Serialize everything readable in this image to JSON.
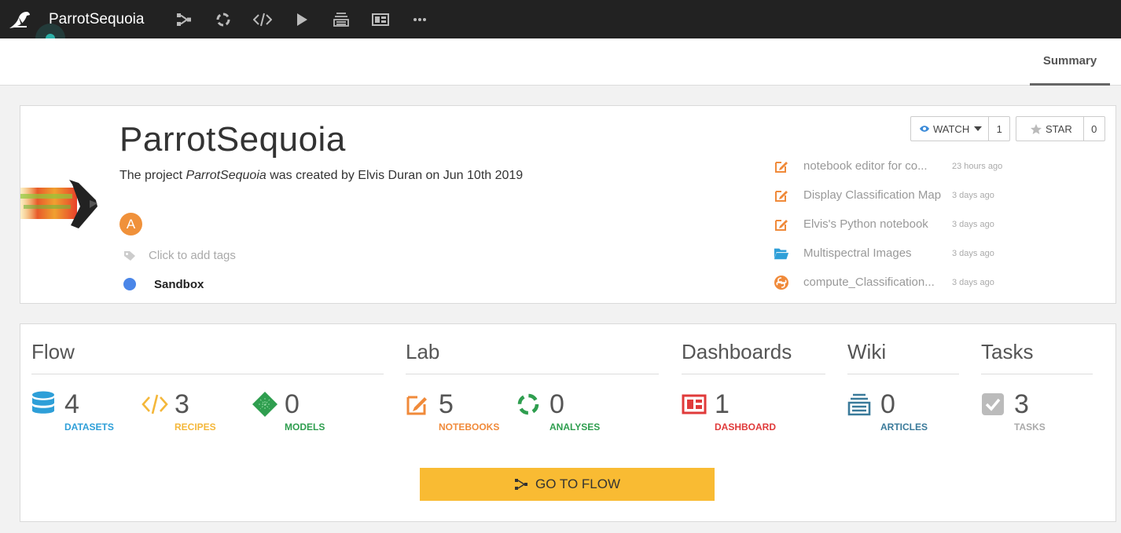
{
  "topbar": {
    "project_name": "ParrotSequoia",
    "icons": [
      "flow-icon",
      "analyses-icon",
      "code-icon",
      "run-icon",
      "wiki-icon",
      "dashboard-icon",
      "more-icon"
    ]
  },
  "subnav": {
    "tab_summary": "Summary"
  },
  "project": {
    "title": "ParrotSequoia",
    "desc_prefix": "The project ",
    "desc_project": "ParrotSequoia",
    "desc_suffix": " was created by Elvis Duran on Jun 10th 2019",
    "avatar_letter": "A",
    "tags_placeholder": "Click to add tags",
    "status_label": "Sandbox",
    "status_color": "#4a86e8"
  },
  "social": {
    "watch_label": "WATCH",
    "watch_count": "1",
    "star_label": "STAR",
    "star_count": "0"
  },
  "activity": [
    {
      "name": "notebook editor for co...",
      "time": "23 hours ago",
      "icon": "notebook-icon"
    },
    {
      "name": "Display Classification Map",
      "time": "3 days ago",
      "icon": "notebook-icon"
    },
    {
      "name": "Elvis's Python notebook",
      "time": "3 days ago",
      "icon": "notebook-icon"
    },
    {
      "name": "Multispectral Images",
      "time": "3 days ago",
      "icon": "folder-icon"
    },
    {
      "name": "compute_Classification...",
      "time": "3 days ago",
      "icon": "python-recipe-icon"
    }
  ],
  "sections": {
    "flow": "Flow",
    "lab": "Lab",
    "dashboards": "Dashboards",
    "wiki": "Wiki",
    "tasks": "Tasks"
  },
  "stats": {
    "datasets": {
      "count": "4",
      "label": "DATASETS",
      "color": "#2e9fd8"
    },
    "recipes": {
      "count": "3",
      "label": "RECIPES",
      "color": "#f4b73a"
    },
    "models": {
      "count": "0",
      "label": "MODELS",
      "color": "#2f9e4f"
    },
    "notebooks": {
      "count": "5",
      "label": "NOTEBOOKS",
      "color": "#f08a3a"
    },
    "analyses": {
      "count": "0",
      "label": "ANALYSES",
      "color": "#2f9e4f"
    },
    "dashboards": {
      "count": "1",
      "label": "DASHBOARD",
      "color": "#e03a3a"
    },
    "articles": {
      "count": "0",
      "label": "ARTICLES",
      "color": "#3a7a9a"
    },
    "tasks": {
      "count": "3",
      "label": "TASKS",
      "color": "#aaaaaa"
    }
  },
  "go_to_flow_label": "GO TO FLOW"
}
